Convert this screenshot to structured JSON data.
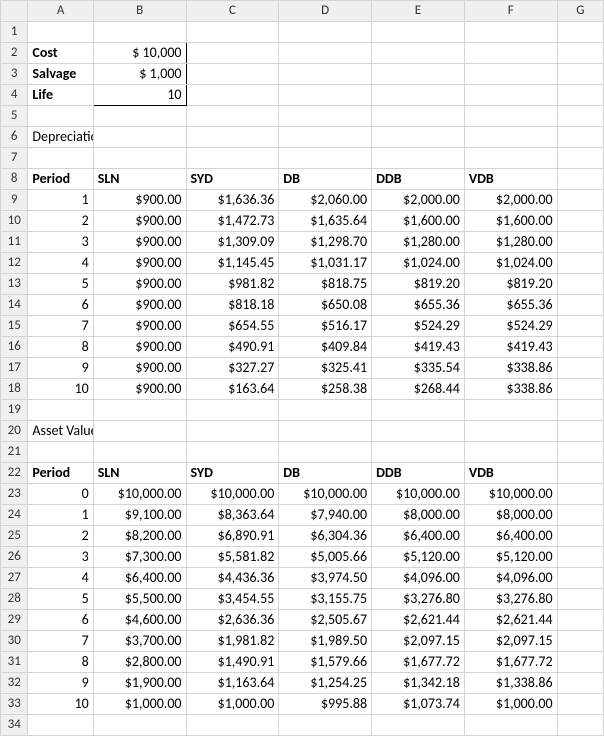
{
  "columns": [
    "",
    "A",
    "B",
    "C",
    "D",
    "E",
    "F",
    "G"
  ],
  "rowCount": 34,
  "labels": {
    "cost": "Cost",
    "salvage": "Salvage",
    "life": "Life",
    "depreciation": "Depreciation Value",
    "asset": "Asset Value",
    "period": "Period",
    "sln": "SLN",
    "syd": "SYD",
    "db": "DB",
    "ddb": "DDB",
    "vdb": "VDB"
  },
  "inputs": {
    "cost": "$     10,000",
    "salvage": "$       1,000",
    "life": "10"
  },
  "depreciation": {
    "periods": [
      "1",
      "2",
      "3",
      "4",
      "5",
      "6",
      "7",
      "8",
      "9",
      "10"
    ],
    "SLN": [
      "$900.00",
      "$900.00",
      "$900.00",
      "$900.00",
      "$900.00",
      "$900.00",
      "$900.00",
      "$900.00",
      "$900.00",
      "$900.00"
    ],
    "SYD": [
      "$1,636.36",
      "$1,472.73",
      "$1,309.09",
      "$1,145.45",
      "$981.82",
      "$818.18",
      "$654.55",
      "$490.91",
      "$327.27",
      "$163.64"
    ],
    "DB": [
      "$2,060.00",
      "$1,635.64",
      "$1,298.70",
      "$1,031.17",
      "$818.75",
      "$650.08",
      "$516.17",
      "$409.84",
      "$325.41",
      "$258.38"
    ],
    "DDB": [
      "$2,000.00",
      "$1,600.00",
      "$1,280.00",
      "$1,024.00",
      "$819.20",
      "$655.36",
      "$524.29",
      "$419.43",
      "$335.54",
      "$268.44"
    ],
    "VDB": [
      "$2,000.00",
      "$1,600.00",
      "$1,280.00",
      "$1,024.00",
      "$819.20",
      "$655.36",
      "$524.29",
      "$419.43",
      "$338.86",
      "$338.86"
    ]
  },
  "asset": {
    "periods": [
      "0",
      "1",
      "2",
      "3",
      "4",
      "5",
      "6",
      "7",
      "8",
      "9",
      "10"
    ],
    "SLN": [
      "$10,000.00",
      "$9,100.00",
      "$8,200.00",
      "$7,300.00",
      "$6,400.00",
      "$5,500.00",
      "$4,600.00",
      "$3,700.00",
      "$2,800.00",
      "$1,900.00",
      "$1,000.00"
    ],
    "SYD": [
      "$10,000.00",
      "$8,363.64",
      "$6,890.91",
      "$5,581.82",
      "$4,436.36",
      "$3,454.55",
      "$2,636.36",
      "$1,981.82",
      "$1,490.91",
      "$1,163.64",
      "$1,000.00"
    ],
    "DB": [
      "$10,000.00",
      "$7,940.00",
      "$6,304.36",
      "$5,005.66",
      "$3,974.50",
      "$3,155.75",
      "$2,505.67",
      "$1,989.50",
      "$1,579.66",
      "$1,254.25",
      "$995.88"
    ],
    "DDB": [
      "$10,000.00",
      "$8,000.00",
      "$6,400.00",
      "$5,120.00",
      "$4,096.00",
      "$3,276.80",
      "$2,621.44",
      "$2,097.15",
      "$1,677.72",
      "$1,342.18",
      "$1,073.74"
    ],
    "VDB": [
      "$10,000.00",
      "$8,000.00",
      "$6,400.00",
      "$5,120.00",
      "$4,096.00",
      "$3,276.80",
      "$2,621.44",
      "$2,097.15",
      "$1,677.72",
      "$1,338.86",
      "$1,000.00"
    ]
  },
  "chart_data": [
    {
      "type": "table",
      "title": "Depreciation Value",
      "categories": [
        "1",
        "2",
        "3",
        "4",
        "5",
        "6",
        "7",
        "8",
        "9",
        "10"
      ],
      "series": [
        {
          "name": "SLN",
          "values": [
            900,
            900,
            900,
            900,
            900,
            900,
            900,
            900,
            900,
            900
          ]
        },
        {
          "name": "SYD",
          "values": [
            1636.36,
            1472.73,
            1309.09,
            1145.45,
            981.82,
            818.18,
            654.55,
            490.91,
            327.27,
            163.64
          ]
        },
        {
          "name": "DB",
          "values": [
            2060,
            1635.64,
            1298.7,
            1031.17,
            818.75,
            650.08,
            516.17,
            409.84,
            325.41,
            258.38
          ]
        },
        {
          "name": "DDB",
          "values": [
            2000,
            1600,
            1280,
            1024,
            819.2,
            655.36,
            524.29,
            419.43,
            335.54,
            268.44
          ]
        },
        {
          "name": "VDB",
          "values": [
            2000,
            1600,
            1280,
            1024,
            819.2,
            655.36,
            524.29,
            419.43,
            338.86,
            338.86
          ]
        }
      ]
    },
    {
      "type": "table",
      "title": "Asset Value",
      "categories": [
        "0",
        "1",
        "2",
        "3",
        "4",
        "5",
        "6",
        "7",
        "8",
        "9",
        "10"
      ],
      "series": [
        {
          "name": "SLN",
          "values": [
            10000,
            9100,
            8200,
            7300,
            6400,
            5500,
            4600,
            3700,
            2800,
            1900,
            1000
          ]
        },
        {
          "name": "SYD",
          "values": [
            10000,
            8363.64,
            6890.91,
            5581.82,
            4436.36,
            3454.55,
            2636.36,
            1981.82,
            1490.91,
            1163.64,
            1000
          ]
        },
        {
          "name": "DB",
          "values": [
            10000,
            7940,
            6304.36,
            5005.66,
            3974.5,
            3155.75,
            2505.67,
            1989.5,
            1579.66,
            1254.25,
            995.88
          ]
        },
        {
          "name": "DDB",
          "values": [
            10000,
            8000,
            6400,
            5120,
            4096,
            3276.8,
            2621.44,
            2097.15,
            1677.72,
            1342.18,
            1073.74
          ]
        },
        {
          "name": "VDB",
          "values": [
            10000,
            8000,
            6400,
            5120,
            4096,
            3276.8,
            2621.44,
            2097.15,
            1677.72,
            1338.86,
            1000
          ]
        }
      ]
    }
  ]
}
